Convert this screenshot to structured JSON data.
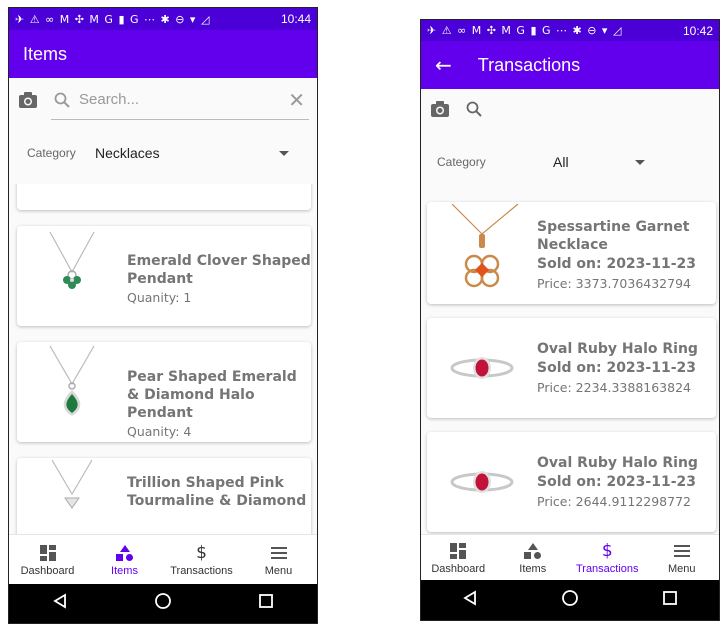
{
  "left": {
    "status": {
      "icons": "✈ ⚠ ∞ M ✣ M G ▮ G ⋯ ✱ ⊖ ▾ ◿ ▮",
      "time": "10:44"
    },
    "title": "Items",
    "search": {
      "placeholder": "Search..."
    },
    "category": {
      "label": "Category",
      "value": "Necklaces"
    },
    "items": [
      {
        "name": "Emerald Clover Shaped Pendant",
        "quantity": "Quanity: 1"
      },
      {
        "name": "Pear Shaped Emerald & Diamond Halo Pendant",
        "quantity": "Quanity: 4"
      },
      {
        "name": "Trillion Shaped Pink Tourmaline & Diamond",
        "quantity": ""
      }
    ],
    "nav": [
      "Dashboard",
      "Items",
      "Transactions",
      "Menu"
    ]
  },
  "right": {
    "status": {
      "icons": "✈ ⚠ ∞ M ✣ M G ▮ G ⋯ ✱ ⊖ ▾ ◿ ▮",
      "time": "10:42"
    },
    "title": "Transactions",
    "category": {
      "label": "Category",
      "value": "All"
    },
    "transactions": [
      {
        "name": "Spessartine Garnet Necklace",
        "sold": "Sold on: 2023-11-23",
        "price": "Price: 3373.7036432794"
      },
      {
        "name": "Oval Ruby Halo Ring",
        "sold": "Sold on: 2023-11-23",
        "price": "Price: 2234.3388163824"
      },
      {
        "name": "Oval Ruby Halo Ring",
        "sold": "Sold on: 2023-11-23",
        "price": "Price: 2644.9112298772"
      }
    ],
    "nav": [
      "Dashboard",
      "Items",
      "Transactions",
      "Menu"
    ]
  },
  "colors": {
    "primary": "#6200ee",
    "status": "#4a00d6",
    "text": "#757575"
  },
  "icons": [
    "camera-icon",
    "search-icon",
    "close-icon",
    "back-arrow-icon",
    "dashboard-icon",
    "shapes-icon",
    "dollar-icon",
    "menu-icon",
    "back-triangle-icon",
    "home-circle-icon",
    "recents-square-icon"
  ]
}
